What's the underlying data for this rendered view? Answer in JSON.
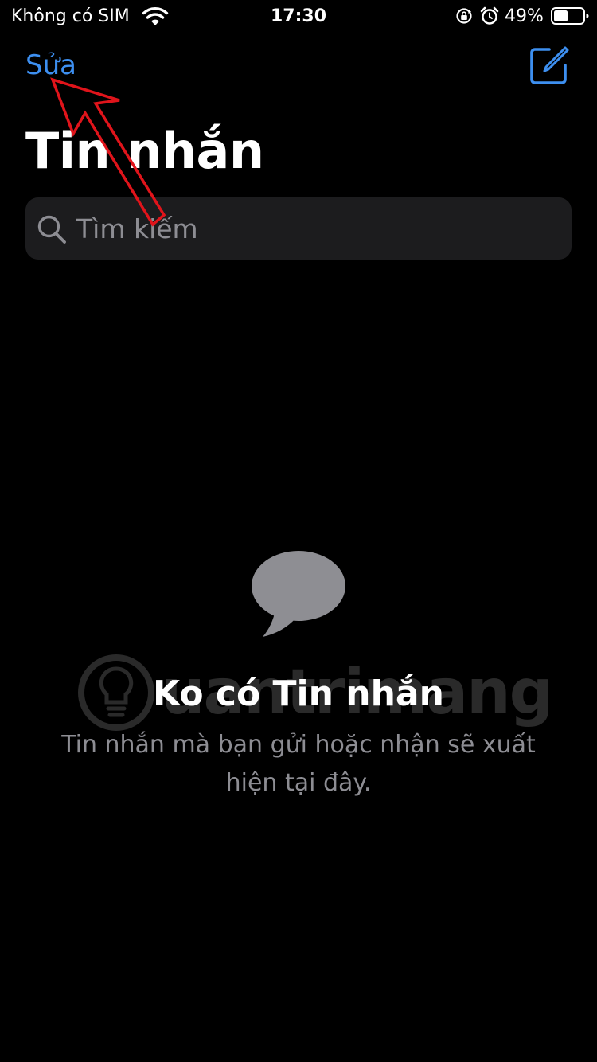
{
  "status_bar": {
    "carrier": "Không có SIM",
    "time": "17:30",
    "battery_percent": "49%",
    "battery_level": 0.49,
    "icons": [
      "wifi-icon",
      "rotation-lock-icon",
      "alarm-icon",
      "battery-icon"
    ]
  },
  "nav": {
    "edit_label": "Sửa",
    "compose_icon": "compose-icon"
  },
  "page": {
    "title": "Tin nhắn"
  },
  "search": {
    "placeholder": "Tìm kiếm",
    "value": ""
  },
  "empty_state": {
    "icon": "message-bubble-icon",
    "title": "Ko có Tin nhắn",
    "description": "Tin nhắn mà bạn gửi hoặc nhận sẽ xuất hiện tại đây."
  },
  "watermark": {
    "text": "uantrimang"
  },
  "colors": {
    "background": "#000000",
    "accent": "#3d8ff0",
    "search_background": "#1c1c1e",
    "secondary_text": "#8d8d93",
    "bubble": "#8e8e93",
    "annotation": "#e0141b"
  }
}
